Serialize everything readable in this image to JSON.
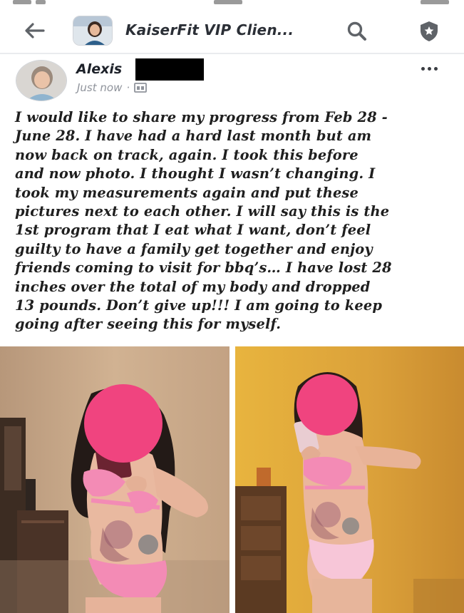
{
  "header": {
    "group_title": "KaiserFit VIP Clien...",
    "icons": [
      "back-arrow-icon",
      "search-icon",
      "shield-star-icon"
    ]
  },
  "post": {
    "author": "Alexis",
    "timestamp": "Just now",
    "separator": "·",
    "audience_icon": "group-audience-icon",
    "lines": [
      "I would like to share my progress from Feb 28 -",
      "June 28. I have had a hard last month but am",
      "now back on track, again. I took this before",
      "and now photo. I thought I wasn’t changing.  I",
      "took my measurements again and put these",
      "pictures next to each other. I will say this is the",
      "1st program that I eat what I want, don’t feel",
      "guilty to have a family get together and enjoy",
      "friends coming to visit for bbq’s… I have lost 28",
      "inches over the total of my body and dropped",
      "13 pounds. Don’t give up!!! I am going to keep",
      "going after seeing this for myself."
    ]
  },
  "photos": [
    {
      "label": "before-photo",
      "background": "#c9a888",
      "face_blur": "#f0447f"
    },
    {
      "label": "after-photo",
      "background": "#e0a83a",
      "face_blur": "#f0447f"
    }
  ],
  "colors": {
    "face_blur": "#f0447f",
    "swimsuit": "#f38bb5",
    "redaction": "#000000",
    "title_text": "#2b2f36"
  }
}
